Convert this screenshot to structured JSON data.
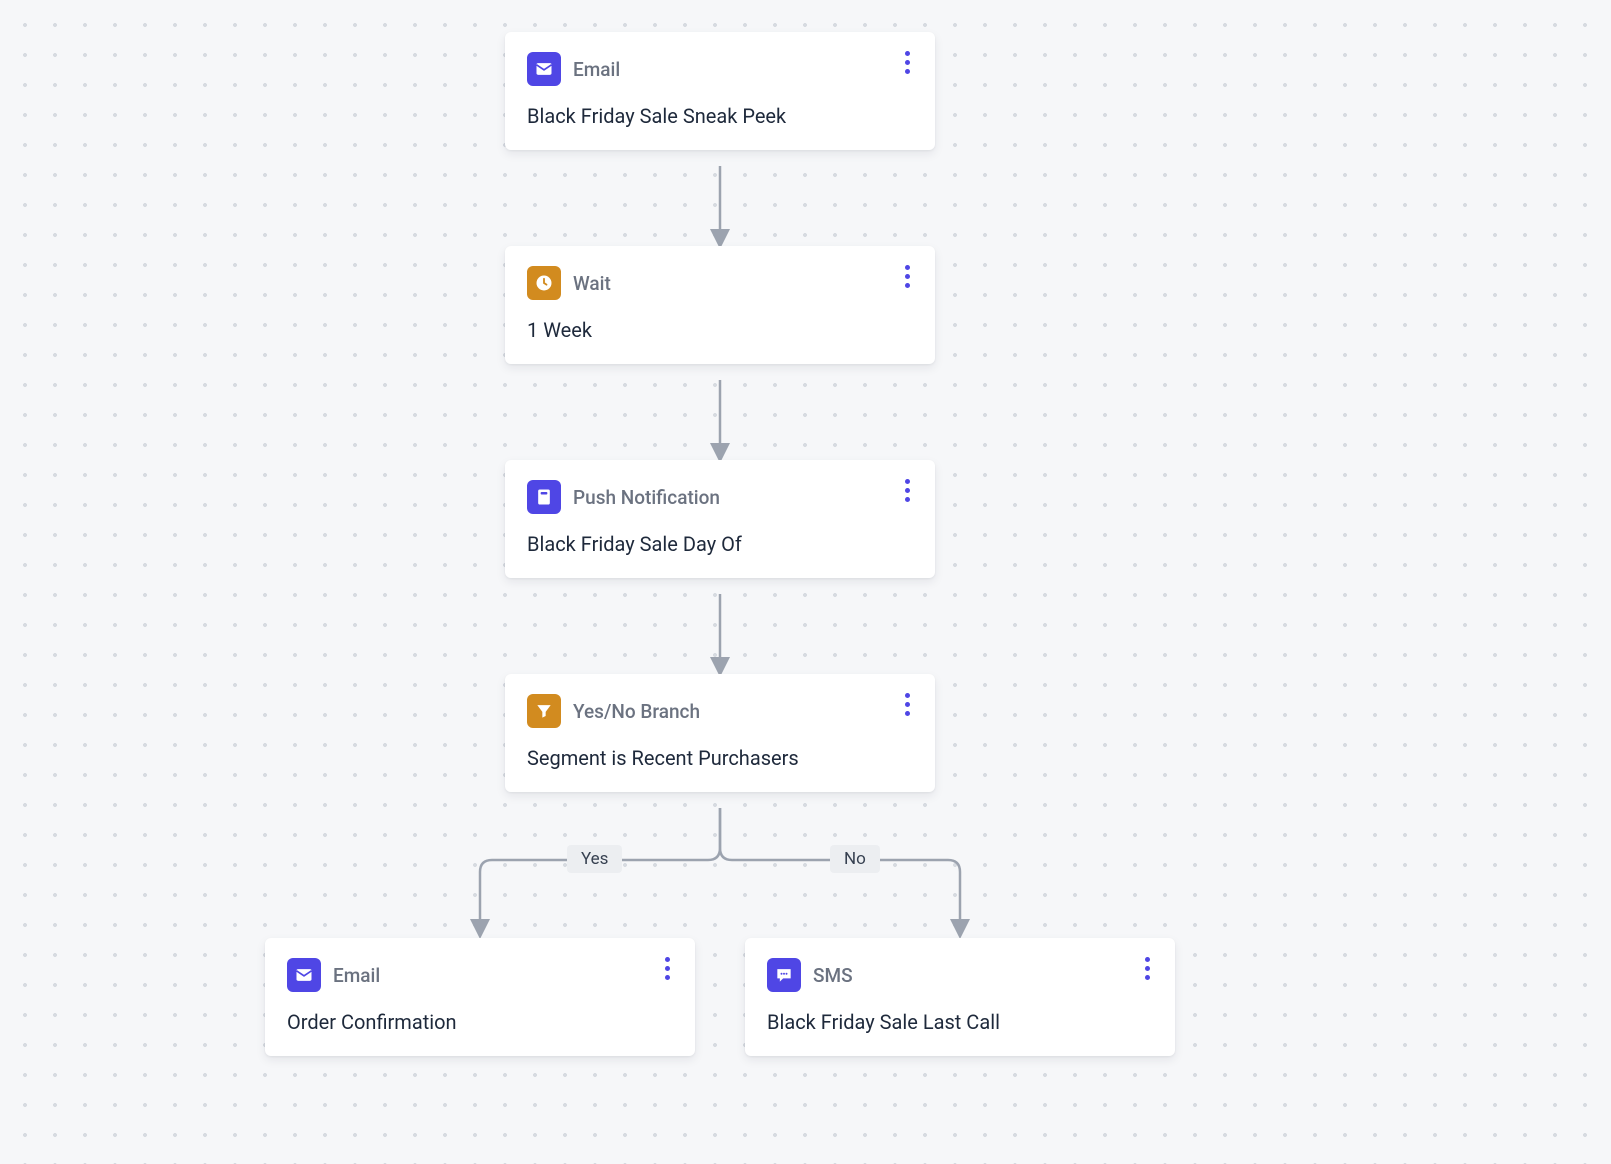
{
  "nodes": {
    "n1": {
      "type": "Email",
      "title": "Black Friday Sale Sneak Peek"
    },
    "n2": {
      "type": "Wait",
      "title": "1 Week"
    },
    "n3": {
      "type": "Push Notification",
      "title": "Black Friday Sale Day Of"
    },
    "n4": {
      "type": "Yes/No Branch",
      "title": "Segment is Recent Purchasers"
    },
    "n5": {
      "type": "Email",
      "title": "Order Confirmation"
    },
    "n6": {
      "type": "SMS",
      "title": "Black Friday Sale Last Call"
    }
  },
  "branch": {
    "yes": "Yes",
    "no": "No"
  },
  "colors": {
    "purple": "#4f46e5",
    "amber": "#d28b1f",
    "line": "#9ca3af"
  }
}
